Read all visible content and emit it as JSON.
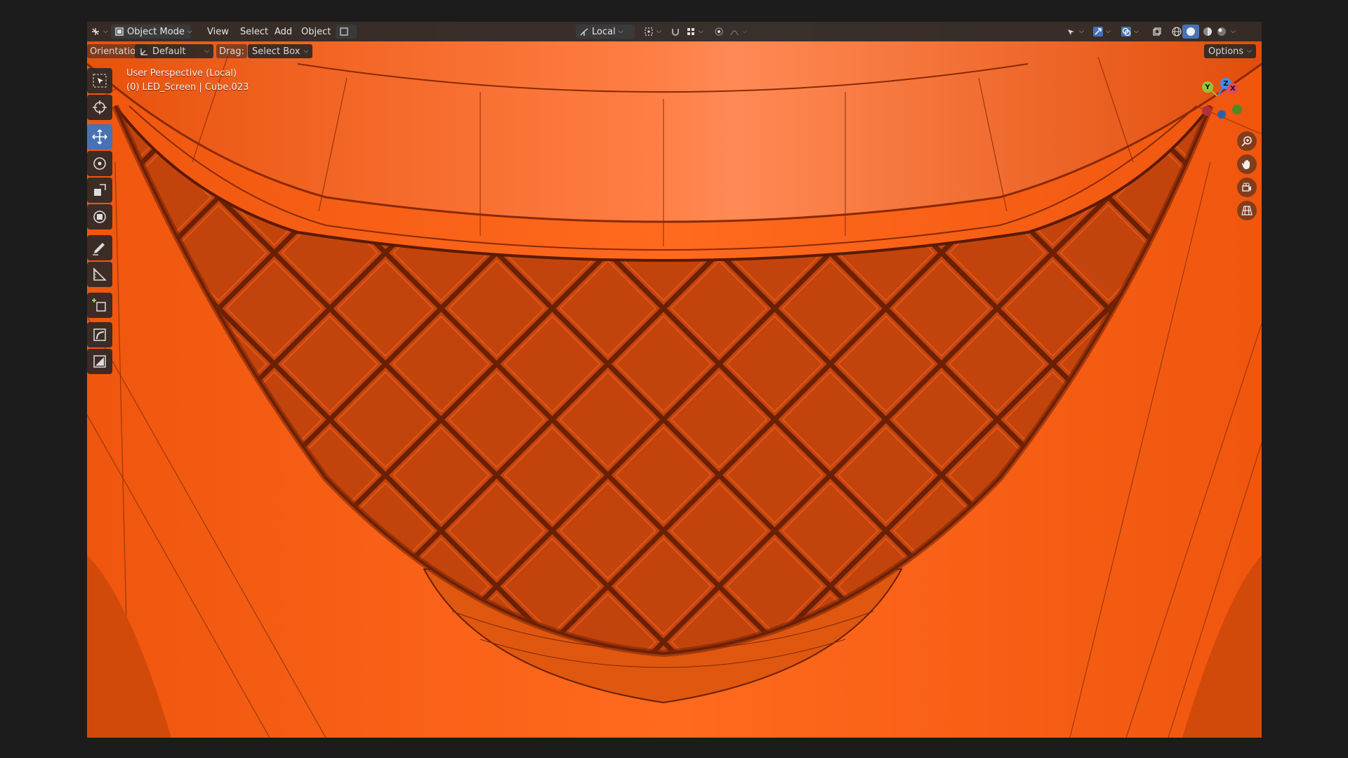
{
  "header": {
    "mode": "Object Mode",
    "menus": [
      "View",
      "Select",
      "Add",
      "Object"
    ],
    "transform_pivot": "Local"
  },
  "tool_settings": {
    "orientation_label": "Orientation:",
    "orientation_value": "Default",
    "drag_label": "Drag:",
    "drag_value": "Select Box",
    "options_label": "Options"
  },
  "viewport": {
    "perspective": "User Perspective (Local)",
    "object_info": "(0) LED_Screen | Cube.023"
  },
  "gizmo": {
    "x": "X",
    "y": "Y",
    "z": "Z"
  },
  "tools": [
    {
      "name": "select-box-tool"
    },
    {
      "name": "cursor-tool"
    },
    {
      "name": "move-tool"
    },
    {
      "name": "rotate-tool"
    },
    {
      "name": "scale-tool"
    },
    {
      "name": "transform-tool"
    },
    {
      "name": "annotate-tool"
    },
    {
      "name": "measure-tool"
    },
    {
      "name": "add-cube-tool"
    },
    {
      "name": "extra-tool-1"
    },
    {
      "name": "extra-tool-2"
    }
  ],
  "colors": {
    "model_orange": "#f25a10",
    "shadow": "#8a2a05",
    "header_bg": "#282828",
    "active_tool": "#4772b3"
  }
}
